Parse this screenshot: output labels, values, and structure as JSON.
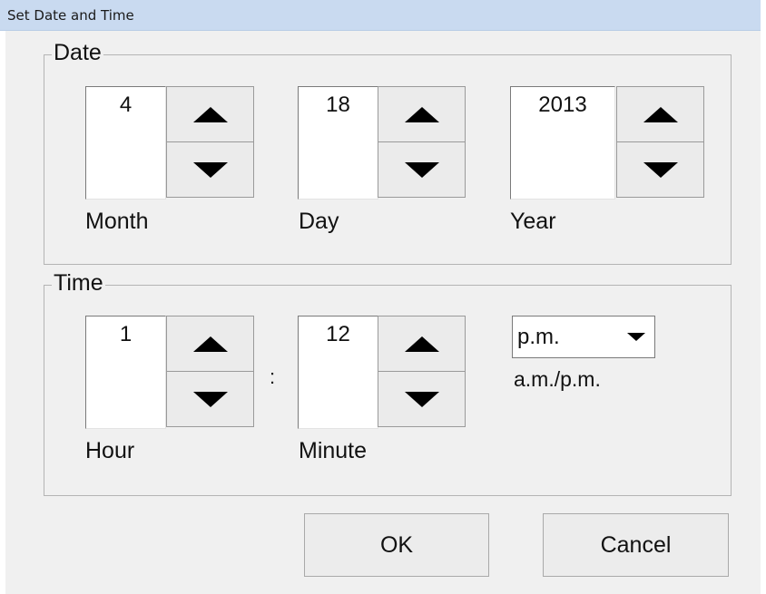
{
  "window": {
    "title": "Set Date and Time"
  },
  "date": {
    "legend": "Date",
    "month": {
      "value": "4",
      "label": "Month"
    },
    "day": {
      "value": "18",
      "label": "Day"
    },
    "year": {
      "value": "2013",
      "label": "Year"
    }
  },
  "time": {
    "legend": "Time",
    "hour": {
      "value": "1",
      "label": "Hour"
    },
    "separator": ":",
    "minute": {
      "value": "12",
      "label": "Minute"
    },
    "ampm": {
      "value": "p.m.",
      "label": "a.m./p.m."
    }
  },
  "buttons": {
    "ok": "OK",
    "cancel": "Cancel"
  },
  "icons": {
    "increment": "triangle-up-icon",
    "decrement": "triangle-down-icon",
    "dropdown": "chevron-down-icon"
  }
}
